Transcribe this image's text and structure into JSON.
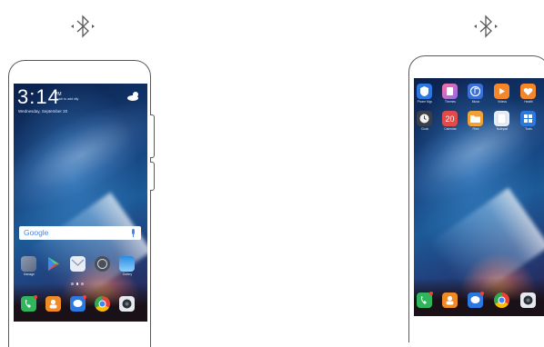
{
  "left_phone": {
    "lock_time": "3:14",
    "lock_ampm": "PM",
    "lock_subtext": "Touch to add city",
    "lock_date": "Wednesday, September 20",
    "search_text": "Google",
    "app_labels": [
      "Manage",
      "",
      "",
      "",
      "Gallery"
    ]
  },
  "right_phone": {
    "row1_labels": [
      "Phone Mgr.",
      "Themes",
      "Music",
      "Videos",
      "Health"
    ],
    "row2_labels": [
      "Clock",
      "Calendar",
      "Files",
      "Notepad",
      "Tools"
    ],
    "calendar_day": "20"
  },
  "colors": {
    "bluetooth": "#5a5a5a",
    "phone_outline": "#5a5a5a",
    "google_blue": "#4285f4"
  }
}
